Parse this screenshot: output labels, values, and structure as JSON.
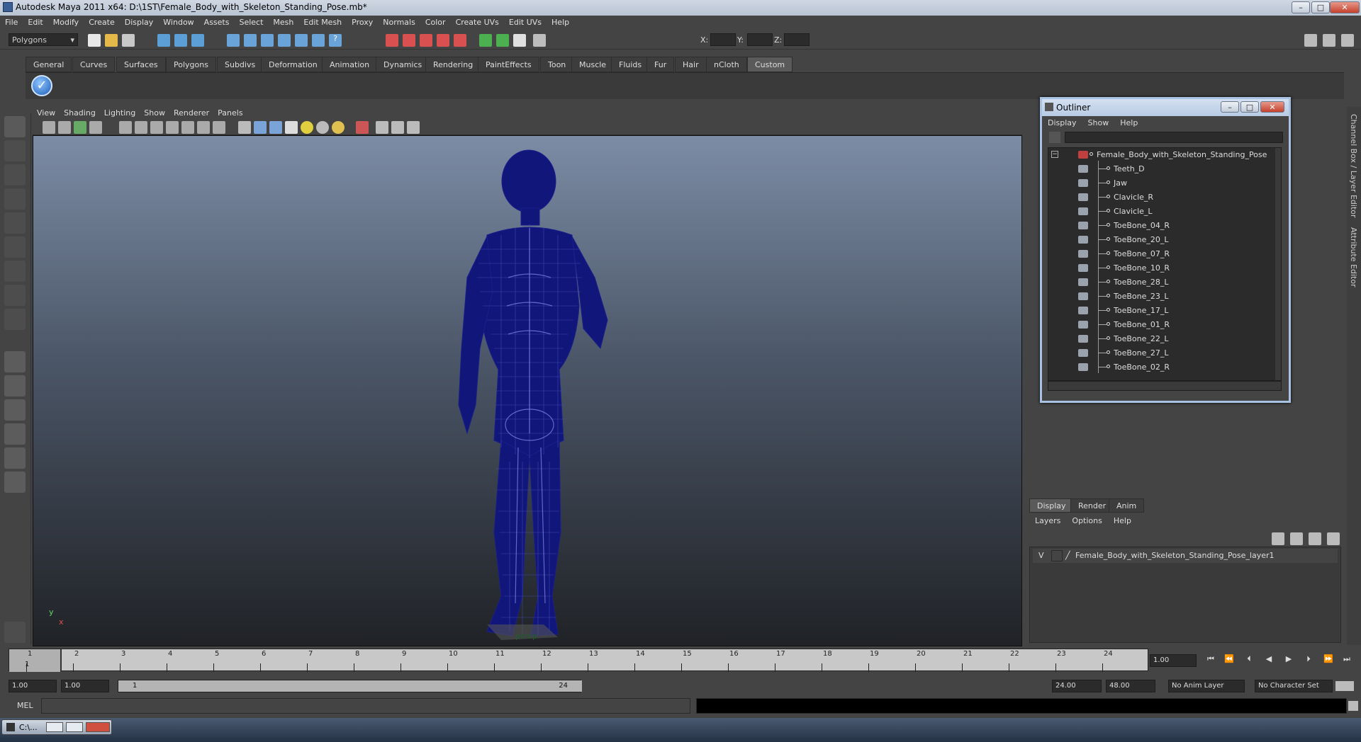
{
  "window": {
    "title": "Autodesk Maya 2011 x64: D:\\1ST\\Female_Body_with_Skeleton_Standing_Pose.mb*"
  },
  "menubar": [
    "File",
    "Edit",
    "Modify",
    "Create",
    "Display",
    "Window",
    "Assets",
    "Select",
    "Mesh",
    "Edit Mesh",
    "Proxy",
    "Normals",
    "Color",
    "Create UVs",
    "Edit UVs",
    "Help"
  ],
  "statusline": {
    "menuset": "Polygons",
    "coord_labels": {
      "x": "X:",
      "y": "Y:",
      "z": "Z:"
    }
  },
  "shelf": {
    "tabs": [
      "General",
      "Curves",
      "Surfaces",
      "Polygons",
      "Subdivs",
      "Deformation",
      "Animation",
      "Dynamics",
      "Rendering",
      "PaintEffects",
      "Toon",
      "Muscle",
      "Fluids",
      "Fur",
      "Hair",
      "nCloth",
      "Custom"
    ],
    "active_tab": "Custom"
  },
  "viewport": {
    "menu": [
      "View",
      "Shading",
      "Lighting",
      "Show",
      "Renderer",
      "Panels"
    ],
    "camera": "persp",
    "axis": {
      "y": "y",
      "x": "x"
    }
  },
  "outliner": {
    "title": "Outliner",
    "menu": [
      "Display",
      "Show",
      "Help"
    ],
    "root": "Female_Body_with_Skeleton_Standing_Pose",
    "items": [
      "Teeth_D",
      "Jaw",
      "Clavicle_R",
      "Clavicle_L",
      "ToeBone_04_R",
      "ToeBone_20_L",
      "ToeBone_07_R",
      "ToeBone_10_R",
      "ToeBone_28_L",
      "ToeBone_23_L",
      "ToeBone_17_L",
      "ToeBone_01_R",
      "ToeBone_22_L",
      "ToeBone_27_L",
      "ToeBone_02_R"
    ]
  },
  "sidebar": {
    "channel_box": "Channel Box / Layer Editor",
    "attribute_editor": "Attribute Editor"
  },
  "layer_editor": {
    "tabs": [
      "Display",
      "Render",
      "Anim"
    ],
    "active_tab": "Display",
    "menu": [
      "Layers",
      "Options",
      "Help"
    ],
    "layers": [
      {
        "visible": "V",
        "name": "Female_Body_with_Skeleton_Standing_Pose_layer1"
      }
    ]
  },
  "timeline": {
    "ticks": [
      "1",
      "2",
      "3",
      "4",
      "5",
      "6",
      "7",
      "8",
      "9",
      "10",
      "11",
      "12",
      "13",
      "14",
      "15",
      "16",
      "17",
      "18",
      "19",
      "20",
      "21",
      "22",
      "23",
      "24"
    ],
    "current_frame": "1",
    "current_time": "1.00"
  },
  "range": {
    "start_time": "1.00",
    "playback_start": "1.00",
    "range_start_label": "1",
    "range_end_label": "24",
    "playback_end": "24.00",
    "end_time": "48.00",
    "anim_layer": "No Anim Layer",
    "character_set": "No Character Set"
  },
  "command_line": {
    "label": "MEL"
  },
  "taskbar": {
    "item": "C:\\..."
  }
}
